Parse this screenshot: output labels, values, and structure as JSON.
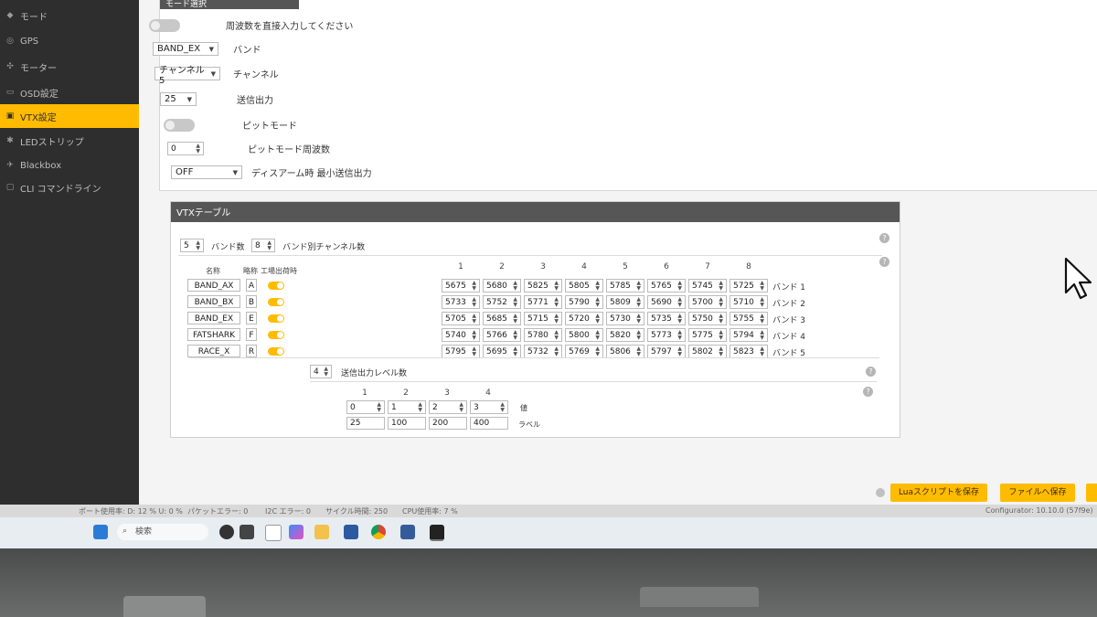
{
  "sidebar": {
    "items": [
      {
        "label": "モード",
        "icon": "mode-icon"
      },
      {
        "label": "GPS",
        "icon": "gps-icon"
      },
      {
        "label": "モーター",
        "icon": "motor-icon"
      },
      {
        "label": "OSD設定",
        "icon": "osd-icon"
      },
      {
        "label": "VTX設定",
        "icon": "vtx-icon",
        "active": true
      },
      {
        "label": "LEDストリップ",
        "icon": "led-icon"
      },
      {
        "label": "Blackbox",
        "icon": "blackbox-icon"
      },
      {
        "label": "CLI コマンドライン",
        "icon": "cli-icon"
      }
    ]
  },
  "mode_panel": {
    "title": "モード選択",
    "direct_freq_label": "周波数を直接入力してください",
    "band_value": "BAND_EX",
    "band_label": "バンド",
    "channel_value": "チャンネル 5",
    "channel_label": "チャンネル",
    "power_value": "25",
    "power_label": "送信出力",
    "pit_label": "ピットモード",
    "pit_freq_value": "0",
    "pit_freq_label": "ピットモード周波数",
    "disarm_value": "OFF",
    "disarm_label": "ディスアーム時 最小送信出力"
  },
  "vtx_table": {
    "title": "VTXテーブル",
    "band_count": "5",
    "band_count_label": "バンド数",
    "channel_count": "8",
    "channel_count_label": "バンド別チャンネル数",
    "headers": {
      "name": "名称",
      "short": "略称",
      "factory": "工場出荷時"
    },
    "columns": [
      "1",
      "2",
      "3",
      "4",
      "5",
      "6",
      "7",
      "8"
    ],
    "bands": [
      {
        "name": "BAND_AX",
        "letter": "A",
        "freqs": [
          "5675",
          "5680",
          "5825",
          "5805",
          "5785",
          "5765",
          "5745",
          "5725"
        ],
        "label": "バンド 1"
      },
      {
        "name": "BAND_BX",
        "letter": "B",
        "freqs": [
          "5733",
          "5752",
          "5771",
          "5790",
          "5809",
          "5690",
          "5700",
          "5710"
        ],
        "label": "バンド 2"
      },
      {
        "name": "BAND_EX",
        "letter": "E",
        "freqs": [
          "5705",
          "5685",
          "5715",
          "5720",
          "5730",
          "5735",
          "5750",
          "5755"
        ],
        "label": "バンド 3"
      },
      {
        "name": "FATSHARK",
        "letter": "F",
        "freqs": [
          "5740",
          "5766",
          "5780",
          "5800",
          "5820",
          "5773",
          "5775",
          "5794"
        ],
        "label": "バンド 4"
      },
      {
        "name": "RACE_X",
        "letter": "R",
        "freqs": [
          "5795",
          "5695",
          "5732",
          "5769",
          "5806",
          "5797",
          "5802",
          "5823"
        ],
        "label": "バンド 5"
      }
    ],
    "power_levels_count": "4",
    "power_levels_label": "送信出力レベル数",
    "power_columns": [
      "1",
      "2",
      "3",
      "4"
    ],
    "power_values": [
      "0",
      "1",
      "2",
      "3"
    ],
    "power_value_label": "値",
    "power_labels": [
      "25",
      "100",
      "200",
      "400"
    ],
    "power_label_label": "ラベル"
  },
  "buttons": {
    "save_lua": "Luaスクリプトを保存",
    "save_file": "ファイルへ保存"
  },
  "statusbar": {
    "port_usage": "ポート使用率: D: 12 % U: 0 %",
    "packet_errors": "パケットエラー: 0",
    "i2c_errors": "I2C エラー: 0",
    "cycle_time": "サイクル時間: 250",
    "cpu_usage": "CPU使用率: 7 %",
    "version": "Configurator: 10.10.0 (57f9e)"
  },
  "taskbar": {
    "search_placeholder": "検索"
  },
  "colors": {
    "accent": "#ffbb00",
    "sidebar_bg": "#2e2e2e",
    "panel_header": "#565656"
  }
}
